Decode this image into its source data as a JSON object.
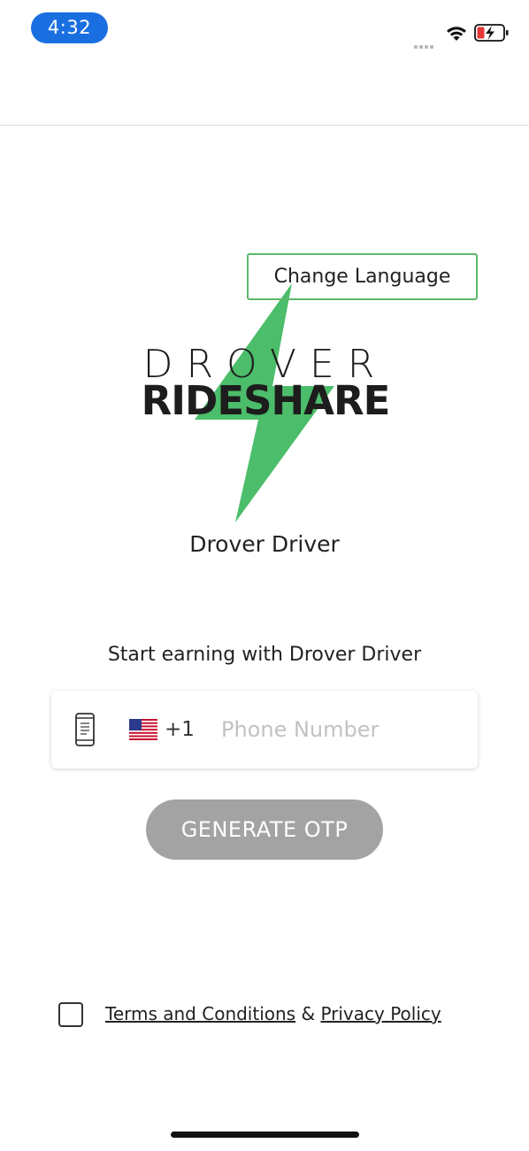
{
  "status_bar": {
    "time": "4:32",
    "icons": [
      "cellular-signal-icon",
      "wifi-icon",
      "battery-charging-icon"
    ]
  },
  "header": {
    "change_language_label": "Change Language"
  },
  "logo": {
    "line1": "DROVER",
    "line2": "RIDESHARE",
    "bolt_color": "#4cbd6a"
  },
  "app_name": "Drover Driver",
  "tagline": "Start earning with Drover Driver",
  "phone": {
    "country_code": "+1",
    "flag": "us-flag-icon",
    "value": "",
    "placeholder": "Phone Number"
  },
  "otp_button_label": "GENERATE OTP",
  "terms": {
    "checked": false,
    "terms_link": "Terms and Conditions",
    "separator": "&",
    "privacy_link": "Privacy Policy"
  },
  "colors": {
    "accent_green": "#5cb86b",
    "time_pill": "#1a6fe0",
    "button_disabled": "#a3a3a3"
  }
}
